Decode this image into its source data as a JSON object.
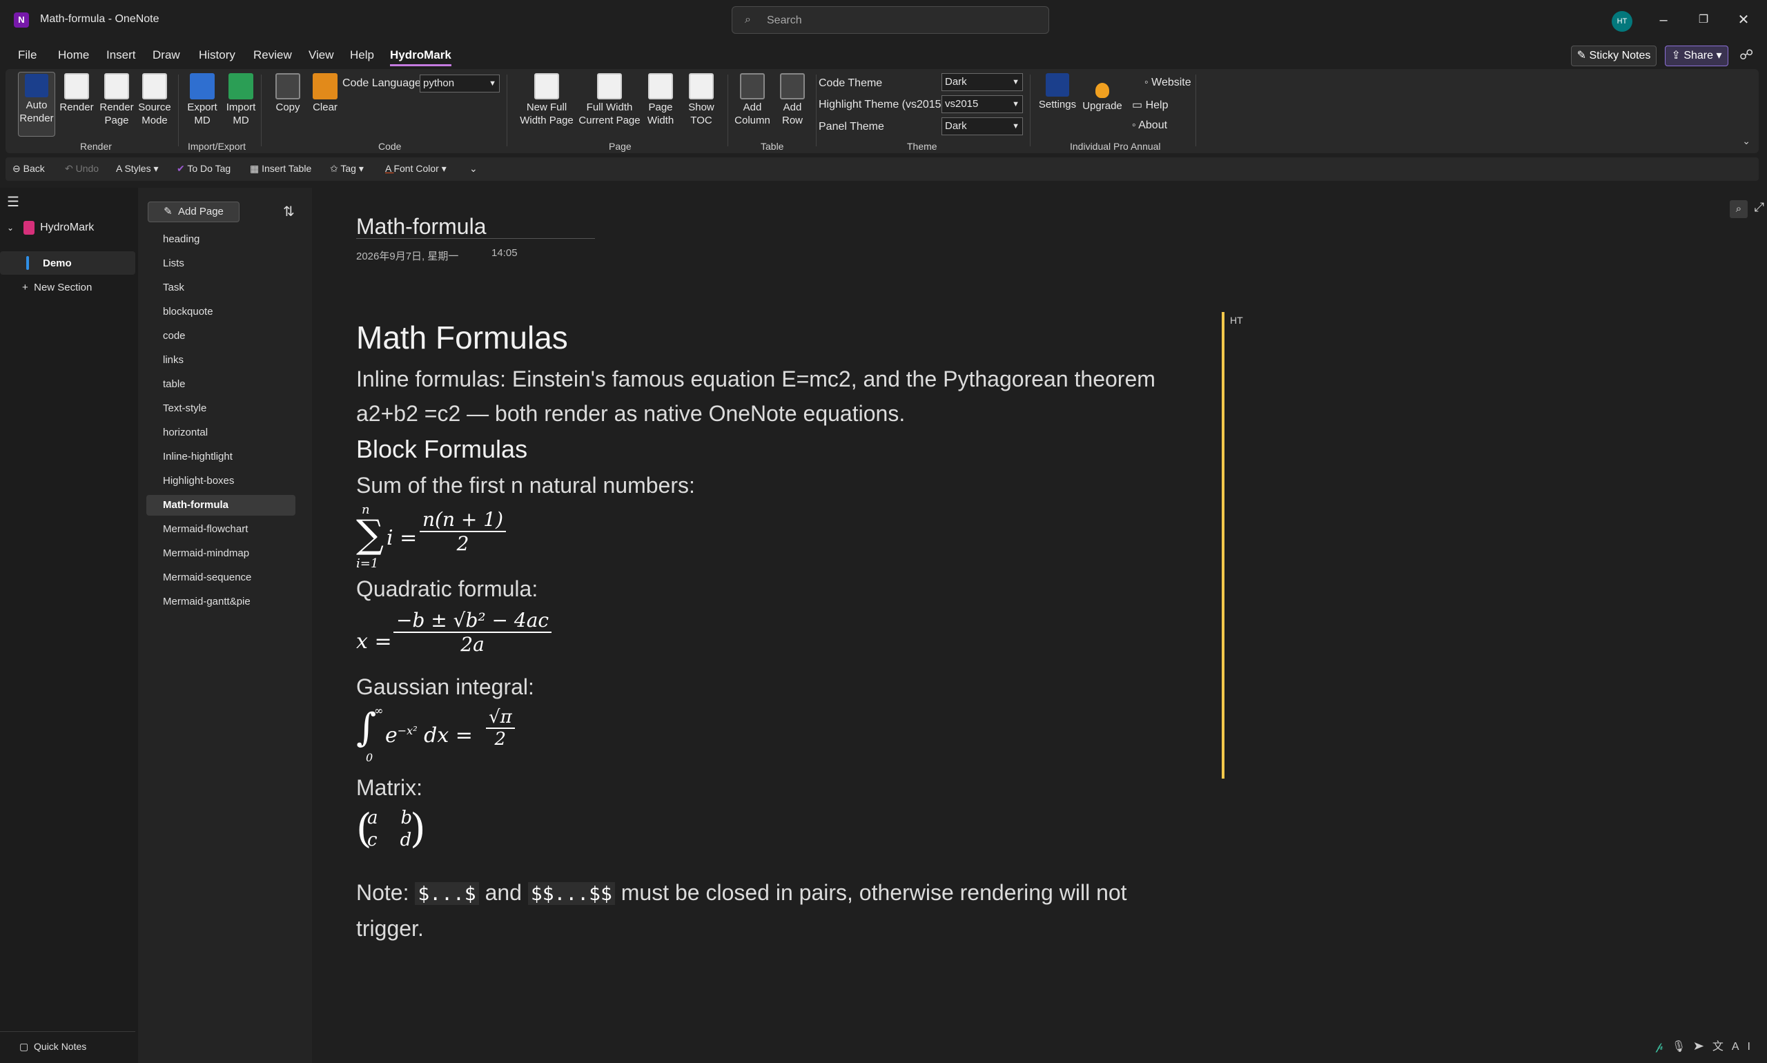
{
  "window": {
    "title": "Math-formula  -  OneNote",
    "app_icon": "N",
    "search_placeholder": "Search",
    "avatar_initials": "HT"
  },
  "menubar": {
    "items": [
      "File",
      "Home",
      "Insert",
      "Draw",
      "History",
      "Review",
      "View",
      "Help",
      "HydroMark"
    ],
    "active": "HydroMark",
    "sticky_notes": "Sticky Notes",
    "share": "Share"
  },
  "ribbon": {
    "render": {
      "auto_render": "Auto\nRender",
      "render": "Render",
      "render_page": "Render\nPage",
      "source_mode": "Source\nMode",
      "label": "Render"
    },
    "import_export": {
      "export_md": "Export\nMD",
      "import_md": "Import\nMD",
      "label": "Import/Export"
    },
    "code": {
      "copy": "Copy",
      "clear": "Clear",
      "code_language_label": "Code Language",
      "code_language_value": "python",
      "label": "Code"
    },
    "page": {
      "new_full_width": "New Full\nWidth Page",
      "full_width_current": "Full Width\nCurrent Page",
      "page_width": "Page\nWidth",
      "show_toc": "Show\nTOC",
      "label": "Page"
    },
    "table": {
      "add_column": "Add\nColumn",
      "add_row": "Add\nRow",
      "label": "Table"
    },
    "theme": {
      "code_theme_label": "Code Theme",
      "code_theme_value": "Dark",
      "highlight_theme_label": "Highlight Theme (vs2015)",
      "highlight_theme_value": "vs2015",
      "panel_theme_label": "Panel Theme",
      "panel_theme_value": "Dark",
      "label": "Theme"
    },
    "pro": {
      "settings": "Settings",
      "upgrade": "Upgrade",
      "website": "Website",
      "help": "Help",
      "about": "About",
      "label": "Individual Pro Annual"
    }
  },
  "qat": {
    "back": "Back",
    "undo": "Undo",
    "styles": "Styles",
    "todo_tag": "To Do Tag",
    "insert_table": "Insert Table",
    "tag": "Tag",
    "font_color": "Font Color"
  },
  "nav": {
    "notebook": "HydroMark",
    "section_active": "Demo",
    "new_section": "New Section",
    "quick_notes": "Quick Notes"
  },
  "pages": {
    "add_page": "Add Page",
    "items": [
      "heading",
      "Lists",
      "Task",
      "blockquote",
      "code",
      "links",
      "table",
      "Text-style",
      "horizontal",
      "Inline-hightlight",
      "Highlight-boxes",
      "Math-formula",
      "Mermaid-flowchart",
      "Mermaid-mindmap",
      "Mermaid-sequence",
      "Mermaid-gantt&pie"
    ],
    "active_index": 11
  },
  "page": {
    "title": "Math-formula",
    "date": "2026年9月7日, 星期一",
    "time": "14:05",
    "side_tag": "HT"
  },
  "content": {
    "h1": "Math Formulas",
    "inline_para": "Inline formulas: Einstein's famous equation E=mc2, and the Pythagorean theorem a2+b2 =c2 — both render as native OneNote equations.",
    "h2": "Block Formulas",
    "sum_label": "Sum of the first n natural numbers:",
    "quadratic_label": "Quadratic formula:",
    "gaussian_label": "Gaussian integral:",
    "matrix_label": "Matrix:",
    "note_prefix": "Note: ",
    "note_code1": "$...$",
    "note_mid": " and ",
    "note_code2": "$$...$$",
    "note_suffix": " must be closed in pairs, otherwise rendering will not trigger."
  },
  "colors": {
    "accent_purple": "#c57be0",
    "section_blue": "#2f8fe6",
    "notebook_pink": "#d6307a",
    "side_bar_yellow": "#f2c84b"
  }
}
